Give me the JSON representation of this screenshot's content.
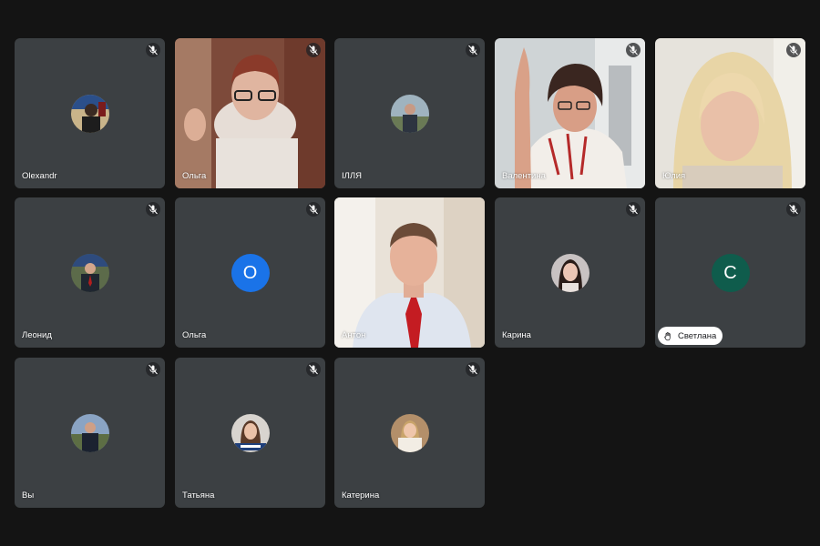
{
  "participants": [
    {
      "name": "Olexandr",
      "type": "photo",
      "muted": true
    },
    {
      "name": "Ольга",
      "type": "video",
      "muted": true
    },
    {
      "name": "ІЛЛЯ",
      "type": "photo",
      "muted": true
    },
    {
      "name": "Валентина",
      "type": "video",
      "muted": true
    },
    {
      "name": "Юлия",
      "type": "video",
      "muted": true
    },
    {
      "name": "Леонид",
      "type": "photo",
      "muted": true
    },
    {
      "name": "Ольга",
      "type": "letter",
      "letter": "О",
      "color": "#1a73e8",
      "muted": true
    },
    {
      "name": "Антон",
      "type": "video",
      "muted": false
    },
    {
      "name": "Карина",
      "type": "photo",
      "muted": true
    },
    {
      "name": "Светлана",
      "type": "letter",
      "letter": "С",
      "color": "#0f5c4c",
      "muted": true,
      "hand_raised": true
    },
    {
      "name": "Вы",
      "type": "photo",
      "muted": true
    },
    {
      "name": "Татьяна",
      "type": "photo",
      "muted": true
    },
    {
      "name": "Катерина",
      "type": "photo",
      "muted": true
    }
  ],
  "icons": {
    "mute": "mic-off-icon",
    "hand": "raised-hand-icon"
  }
}
